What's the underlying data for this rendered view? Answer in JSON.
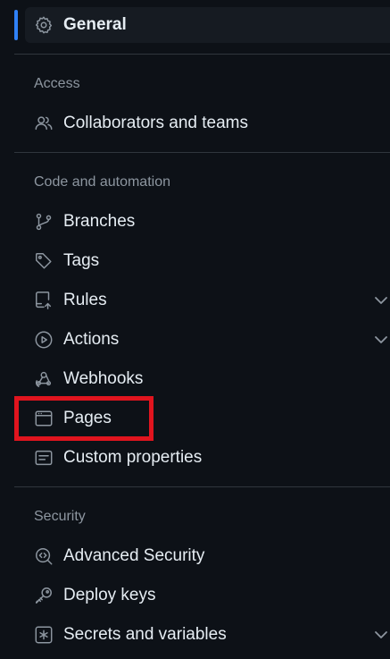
{
  "general": {
    "label": "General",
    "icon": "gear-icon"
  },
  "access": {
    "heading": "Access",
    "items": [
      {
        "label": "Collaborators and teams",
        "icon": "people-icon"
      }
    ]
  },
  "code_automation": {
    "heading": "Code and automation",
    "items": [
      {
        "label": "Branches",
        "icon": "git-branch-icon"
      },
      {
        "label": "Tags",
        "icon": "tag-icon"
      },
      {
        "label": "Rules",
        "icon": "repo-push-icon",
        "expandable": true
      },
      {
        "label": "Actions",
        "icon": "play-icon",
        "expandable": true
      },
      {
        "label": "Webhooks",
        "icon": "webhook-icon"
      },
      {
        "label": "Pages",
        "icon": "browser-icon",
        "highlighted": true
      },
      {
        "label": "Custom properties",
        "icon": "note-icon"
      }
    ]
  },
  "security": {
    "heading": "Security",
    "items": [
      {
        "label": "Advanced Security",
        "icon": "codescan-icon"
      },
      {
        "label": "Deploy keys",
        "icon": "key-icon"
      },
      {
        "label": "Secrets and variables",
        "icon": "asterisk-icon",
        "expandable": true
      }
    ]
  },
  "colors": {
    "background": "#0d1117",
    "active_bar": "#2f81f7",
    "highlight": "#e0141e"
  }
}
